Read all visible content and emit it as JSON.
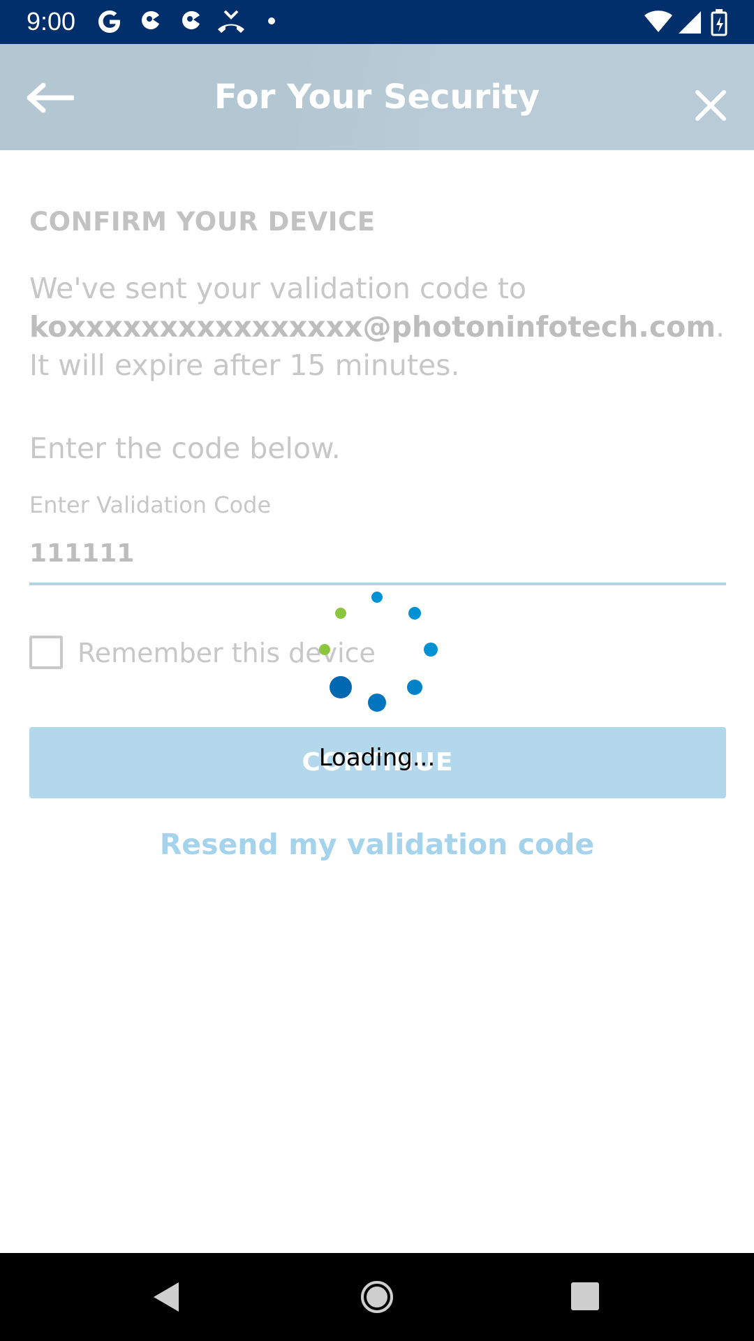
{
  "status_bar": {
    "time": "9:00",
    "left_icons": [
      "google-icon",
      "notification-icon",
      "notification-icon",
      "missed-call-icon",
      "dot-icon"
    ],
    "right_icons": [
      "wifi-icon",
      "signal-icon",
      "battery-icon"
    ]
  },
  "header": {
    "title": "For Your Security",
    "background_color": "#b3c7d3"
  },
  "content": {
    "section_title": "CONFIRM YOUR DEVICE",
    "info_prefix": "We've sent your validation code to",
    "email": "koxxxxxxxxxxxxxxxx@photoninfotech.com",
    "info_suffix": ". It will expire after 15 minutes.",
    "instruction": "Enter the code below.",
    "code_field": {
      "label": "Enter Validation Code",
      "value": "111111"
    },
    "remember_device": {
      "label": "Remember this device",
      "checked": false
    },
    "continue_label": "CONTINUE",
    "resend_label": "Resend my validation code"
  },
  "loading": {
    "text": "Loading...",
    "colors": {
      "green": "#8cc63f",
      "blue": "#0091d5",
      "dark_blue": "#0067b1"
    }
  },
  "nav_bar": {
    "icons": [
      "back-icon",
      "home-icon",
      "recents-icon"
    ]
  }
}
